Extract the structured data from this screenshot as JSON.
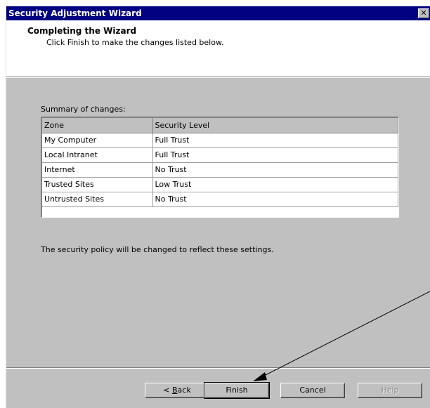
{
  "window": {
    "title": "Security Adjustment Wizard",
    "close_glyph": "✕"
  },
  "header": {
    "title": "Completing the Wizard",
    "subtitle": "Click Finish to make the changes listed below."
  },
  "summary": {
    "label": "Summary of changes:",
    "columns": [
      "Zone",
      "Security Level"
    ],
    "rows": [
      [
        "My Computer",
        "Full Trust"
      ],
      [
        "Local Intranet",
        "Full Trust"
      ],
      [
        "Internet",
        "No Trust"
      ],
      [
        "Trusted Sites",
        "Low Trust"
      ],
      [
        "Untrusted Sites",
        "No Trust"
      ]
    ]
  },
  "policy_note": "The security policy will be changed to reflect these settings.",
  "buttons": {
    "back_prefix": "< ",
    "back_mnemonic": "B",
    "back_rest": "ack",
    "finish": "Finish",
    "cancel": "Cancel",
    "help": "Help"
  },
  "colors": {
    "titlebar": "#000080",
    "face": "#c0c0c0"
  }
}
